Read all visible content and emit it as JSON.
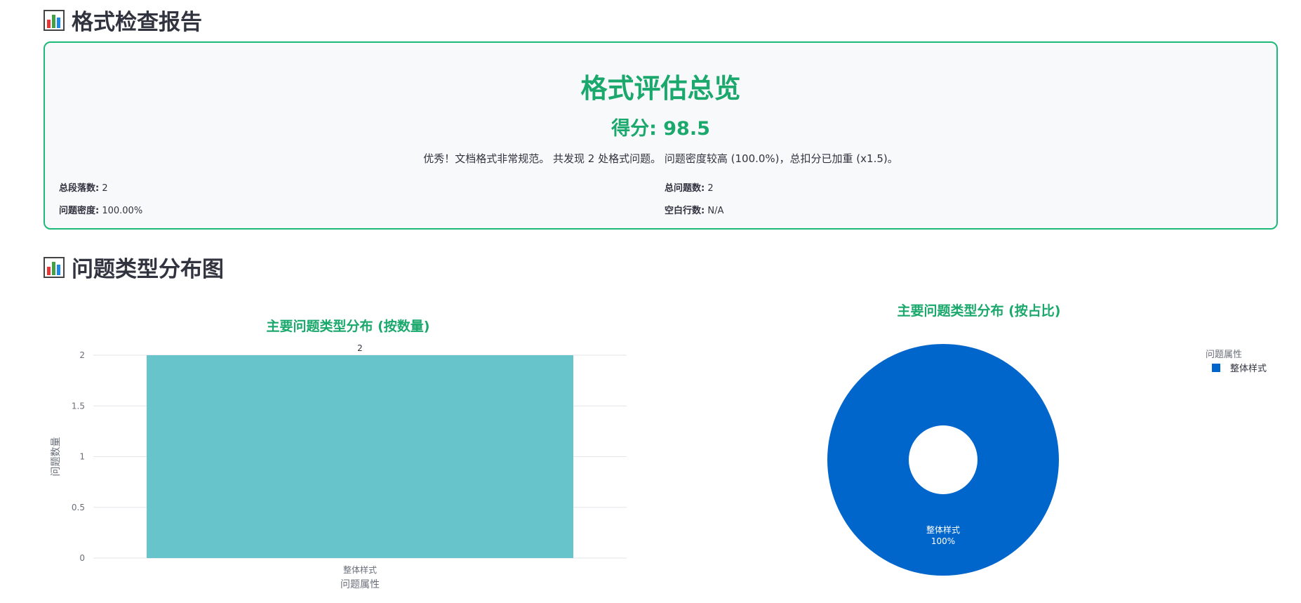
{
  "report": {
    "section1_title": "格式检查报告",
    "section2_title": "问题类型分布图"
  },
  "summary": {
    "heading": "格式评估总览",
    "score_label": "得分: 98.5",
    "description": "优秀！文档格式非常规范。 共发现 2 处格式问题。 问题密度较高 (100.0%)，总扣分已加重 (x1.5)。",
    "stats": [
      {
        "label": "总段落数:",
        "value": "2"
      },
      {
        "label": "总问题数:",
        "value": "2"
      },
      {
        "label": "问题密度:",
        "value": "100.00%"
      },
      {
        "label": "空白行数:",
        "value": "N/A"
      }
    ]
  },
  "colors": {
    "accent": "#1aa86c",
    "card_border": "#1db978",
    "bar": "#67c4cb",
    "pie": "#0066cc"
  },
  "chart_data": [
    {
      "type": "bar",
      "title": "主要问题类型分布 (按数量)",
      "categories": [
        "整体样式"
      ],
      "values": [
        2
      ],
      "data_labels": [
        "2"
      ],
      "xlabel": "问题属性",
      "ylabel": "问题数量",
      "ylim": [
        0,
        2
      ],
      "yticks": [
        "0",
        "0.5",
        "1",
        "1.5",
        "2"
      ],
      "grid": true
    },
    {
      "type": "pie",
      "title": "主要问题类型分布 (按占比)",
      "labels": [
        "整体样式"
      ],
      "values": [
        100
      ],
      "slice_labels": [
        "整体样式",
        "100%"
      ],
      "legend_title": "问题属性",
      "legend_position": "top-right",
      "donut": true
    }
  ]
}
